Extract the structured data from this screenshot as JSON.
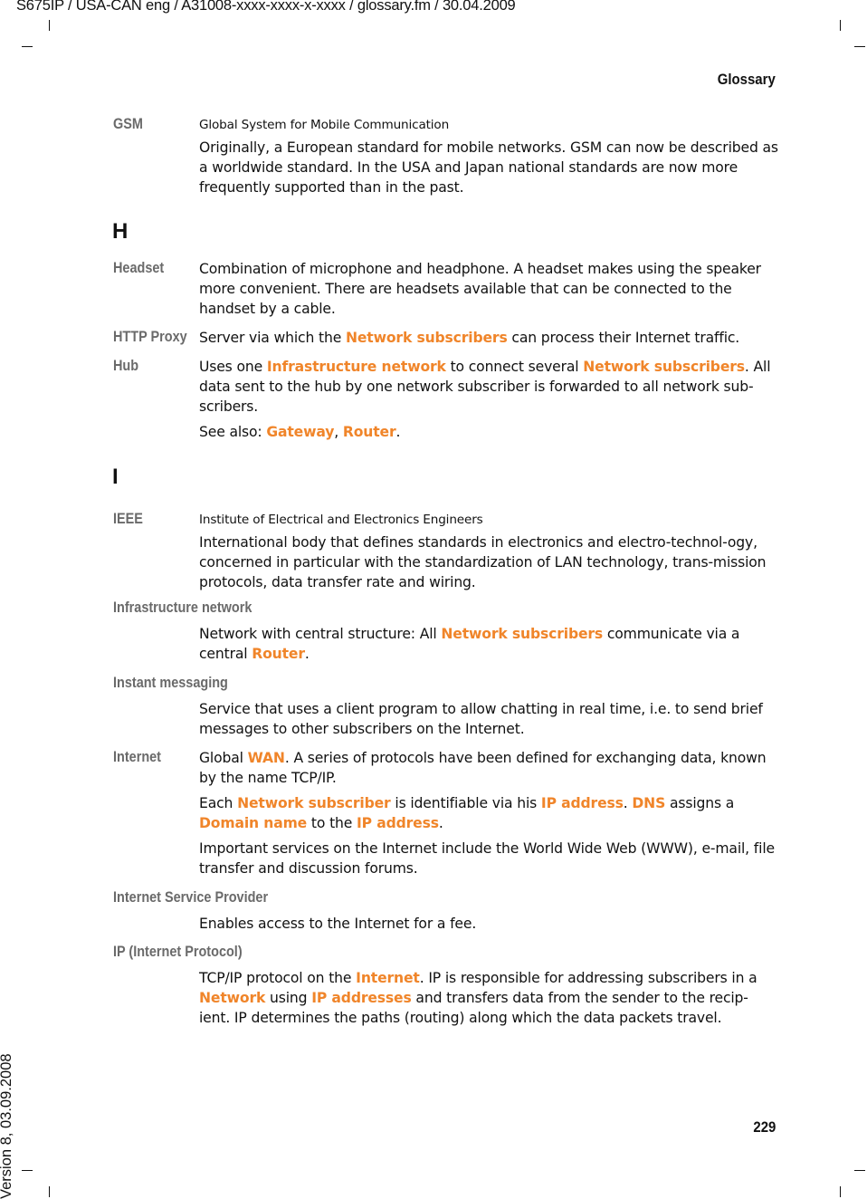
{
  "header": {
    "doc_info": "S675IP  / USA-CAN eng / A31008-xxxx-xxxx-x-xxxx / glossary.fm / 30.04.2009",
    "section": "Glossary"
  },
  "footer": {
    "page_number": "229",
    "version": "Version 8, 03.09.2008"
  },
  "colors": {
    "link": "#f0852a",
    "term": "#6a6a6a"
  },
  "letters": [
    "H",
    "I"
  ],
  "entries": [
    {
      "term": "GSM",
      "sub": "Global System for Mobile Communication",
      "paragraphs": [
        [
          {
            "t": "Originally, a European standard for mobile networks. GSM can now be described as a worldwide standard. In the USA and Japan national standards are now more frequently supported than in the past."
          }
        ]
      ]
    },
    {
      "term": "Headset",
      "paragraphs": [
        [
          {
            "t": "Combination of microphone and headphone. A headset makes using the speaker more convenient. There are headsets available that can be connected to the handset by a cable."
          }
        ]
      ]
    },
    {
      "term": "HTTP Proxy",
      "paragraphs": [
        [
          {
            "t": "Server via which the "
          },
          {
            "l": "Network subscribers"
          },
          {
            "t": " can process their Internet traffic."
          }
        ]
      ]
    },
    {
      "term": "Hub",
      "paragraphs": [
        [
          {
            "t": "Uses one "
          },
          {
            "l": "Infrastructure network"
          },
          {
            "t": " to connect several "
          },
          {
            "l": "Network subscribers"
          },
          {
            "t": ". All data sent to the hub by one network subscriber is forwarded to all network sub-scribers."
          }
        ],
        [
          {
            "t": "See also: "
          },
          {
            "l": "Gateway"
          },
          {
            "t": ", "
          },
          {
            "l": "Router"
          },
          {
            "t": "."
          }
        ]
      ]
    },
    {
      "term": "IEEE",
      "sub": "Institute of Electrical and Electronics Engineers",
      "paragraphs": [
        [
          {
            "t": "International body that defines standards in electronics and electro-technol-ogy, concerned in particular with the standardization of LAN technology, trans-mission protocols, data transfer rate and wiring."
          }
        ]
      ]
    },
    {
      "term": "Infrastructure network",
      "below": true,
      "paragraphs": [
        [
          {
            "t": "Network with central structure: All "
          },
          {
            "l": "Network subscribers"
          },
          {
            "t": " communicate via a central "
          },
          {
            "l": "Router"
          },
          {
            "t": "."
          }
        ]
      ]
    },
    {
      "term": "Instant messaging",
      "below": true,
      "paragraphs": [
        [
          {
            "t": "Service that uses a client program to allow chatting in real time, i.e. to send brief messages to other subscribers on the Internet."
          }
        ]
      ]
    },
    {
      "term": "Internet",
      "paragraphs": [
        [
          {
            "t": "Global "
          },
          {
            "l": "WAN"
          },
          {
            "t": ". A series of protocols have been defined for exchanging data, known by the name TCP/IP."
          }
        ],
        [
          {
            "t": "Each "
          },
          {
            "l": "Network subscriber"
          },
          {
            "t": " is identifiable via his "
          },
          {
            "l": "IP address"
          },
          {
            "t": ". "
          },
          {
            "l": "DNS"
          },
          {
            "t": " assigns a "
          },
          {
            "l": "Domain name"
          },
          {
            "t": " to the "
          },
          {
            "l": "IP address"
          },
          {
            "t": "."
          }
        ],
        [
          {
            "t": "Important services on the Internet include the World Wide Web (WWW), e-mail, file transfer and discussion forums."
          }
        ]
      ]
    },
    {
      "term": "Internet Service Provider",
      "below": true,
      "paragraphs": [
        [
          {
            "t": "Enables access to the Internet for a fee."
          }
        ]
      ]
    },
    {
      "term": "IP (Internet Protocol)",
      "below": true,
      "paragraphs": [
        [
          {
            "t": "TCP/IP protocol on the "
          },
          {
            "l": "Internet"
          },
          {
            "t": ". IP is responsible for addressing subscribers in a "
          },
          {
            "l": "Network"
          },
          {
            "t": " using "
          },
          {
            "l": "IP addresses"
          },
          {
            "t": " and transfers data from the sender to the recip-ient. IP determines the paths (routing) along which the data packets travel."
          }
        ]
      ]
    }
  ]
}
